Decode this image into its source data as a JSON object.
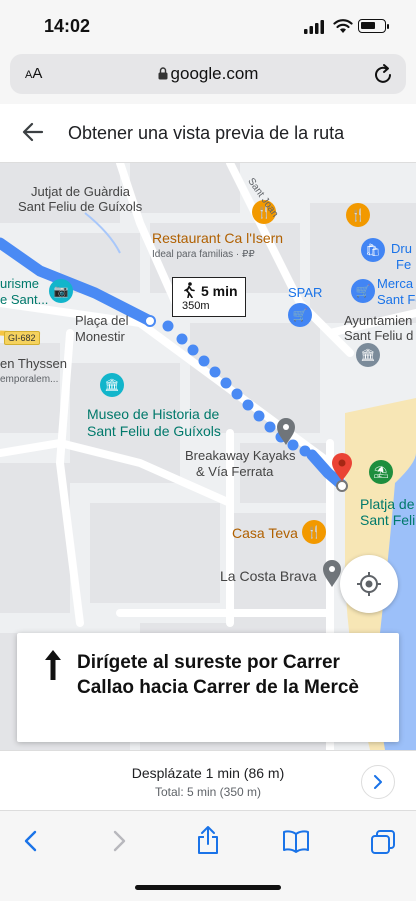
{
  "status": {
    "time": "14:02"
  },
  "browser": {
    "text_size_label": "AA",
    "host": "google.com"
  },
  "header": {
    "title": "Obtener una vista previa de la ruta"
  },
  "map": {
    "labels": {
      "jutjat_1": "Jutjat de Guàrdia",
      "jutjat_2": "Sant Feliu de Guíxols",
      "sant_joan": "Sant Joan",
      "restaurant_name": "Restaurant Ca l'Isern",
      "restaurant_sub": "Ideal para familias · ₽₽",
      "spar": "SPAR",
      "mercat_1": "Merca",
      "mercat_2": "Sant Fe",
      "dru_1": "Dru",
      "dru_2": "Fe",
      "ayunt_1": "Ayuntamien",
      "ayunt_2": "Sant Feliu d",
      "turisme_1": "urisme",
      "turisme_2": "e Sant...",
      "placa_1": "Plaça del",
      "placa_2": "Monestir",
      "thyssen_1": "en Thyssen",
      "thyssen_2": "emporalem...",
      "museo_1": "Museo de Historia de",
      "museo_2": "Sant Feliu de Guíxols",
      "kayaks_1": "Breakaway Kayaks",
      "kayaks_2": "& Vía Ferrata",
      "platja_1": "Platja de",
      "platja_2": "Sant Feli",
      "casa_teva": "Casa Teva",
      "costa_brava": "La Costa Brava",
      "road_badge": "GI-682"
    },
    "walk_badge": {
      "time": "5 min",
      "distance": "350m"
    }
  },
  "direction": {
    "text": "Dirígete al sureste por Carrer Callao hacia Carrer de la Mercè"
  },
  "summary": {
    "line1": "Desplázate 1 min (86 m)",
    "line2": "Total: 5 min (350 m)"
  },
  "colors": {
    "route": "#4a8af4",
    "accent": "#1a73e8",
    "destination": "#ea4335"
  }
}
